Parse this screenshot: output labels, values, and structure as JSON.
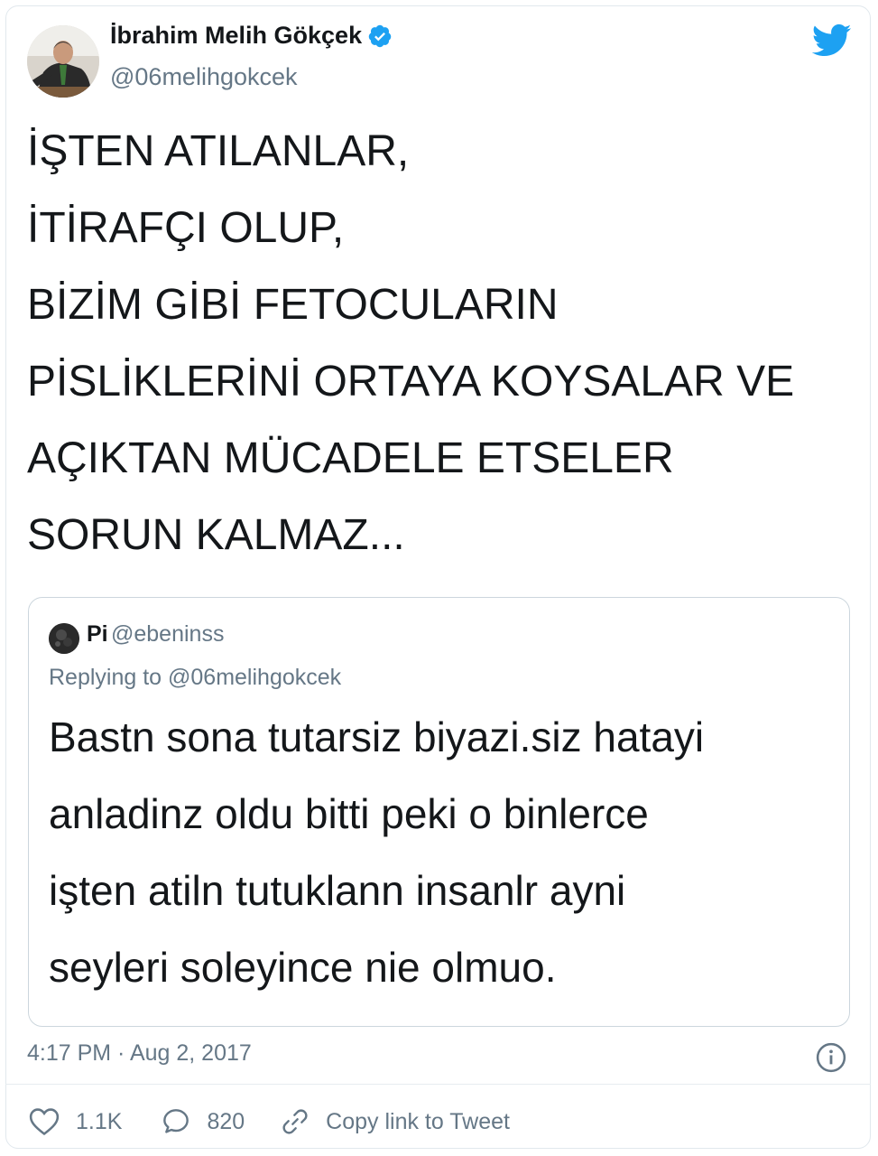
{
  "tweet": {
    "display_name": "İbrahim Melih Gökçek",
    "handle": "@06melihgokcek",
    "text_lines": [
      "İŞTEN ATILANLAR,",
      "İTİRAFÇI OLUP,",
      "BİZİM GİBİ FETOCULARIN",
      "PİSLİKLERİNİ ORTAYA KOYSALAR VE",
      "AÇIKTAN MÜCADELE ETSELER",
      "SORUN KALMAZ..."
    ],
    "timestamp": "4:17 PM · Aug 2, 2017"
  },
  "quoted": {
    "name": "Pi",
    "handle": "@ebeninss",
    "replying_to": "Replying to @06melihgokcek",
    "text_lines": [
      "Bastn sona tutarsiz biyazi.siz hatayi",
      "anladinz oldu bitti peki o binlerce",
      "işten atiln tutuklann insanlr ayni",
      "seyleri soleyince nie olmuo."
    ]
  },
  "actions": {
    "likes": "1.1K",
    "replies": "820",
    "copy_link": "Copy link to Tweet"
  },
  "colors": {
    "twitter_blue": "#1da1f2",
    "text_primary": "#14171a",
    "text_secondary": "#657786",
    "border": "#ccd6dd"
  },
  "icons": [
    "twitter-bird-icon",
    "verified-badge-icon",
    "info-icon",
    "heart-icon",
    "reply-bubble-icon",
    "link-icon"
  ]
}
